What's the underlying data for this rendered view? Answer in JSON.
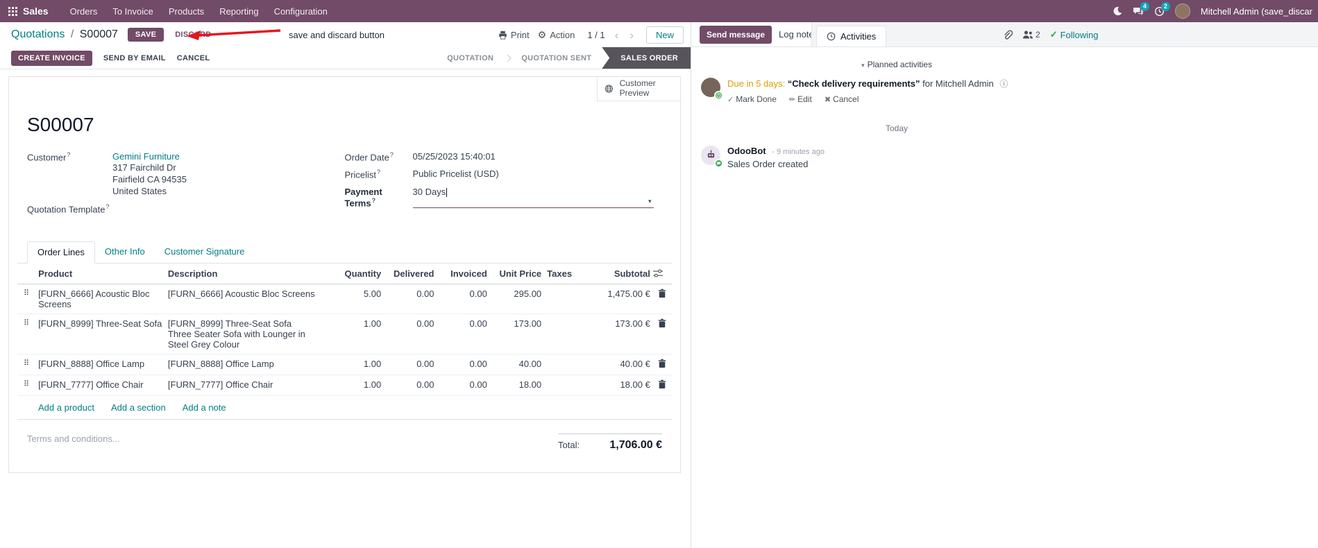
{
  "colors": {
    "primary": "#714B67",
    "link": "#017E84",
    "status_active_bg": "#57545C",
    "warning_text": "#dc9e00",
    "success": "#28a745",
    "badge": "#17a2b8",
    "annotation_red": "#e8141c"
  },
  "nav": {
    "brand": "Sales",
    "menus": [
      "Orders",
      "To Invoice",
      "Products",
      "Reporting",
      "Configuration"
    ],
    "message_badge": "4",
    "activity_badge": "2",
    "user": "Mitchell Admin (save_discar"
  },
  "control": {
    "breadcrumb_parent": "Quotations",
    "breadcrumb_sep": "/",
    "breadcrumb_current": "S00007",
    "save": "SAVE",
    "discard": "DISCARD",
    "annotation": "save and discard button",
    "print": "Print",
    "action": "Action",
    "pager": "1 / 1",
    "prev": "‹",
    "next": "›",
    "new": "New"
  },
  "statusbar": {
    "create_invoice": "CREATE INVOICE",
    "send_by_email": "SEND BY EMAIL",
    "cancel": "CANCEL",
    "stages": [
      {
        "label": "QUOTATION"
      },
      {
        "label": "QUOTATION SENT"
      },
      {
        "label": "SALES ORDER"
      }
    ]
  },
  "sheet": {
    "customer_preview": "Customer Preview",
    "title": "S00007",
    "help_marker": "?",
    "customer_label": "Customer",
    "customer_name": "Gemini Furniture",
    "address_line1": "317 Fairchild Dr",
    "address_line2": "Fairfield CA 94535",
    "address_line3": "United States",
    "quotation_template_label": "Quotation Template",
    "order_date_label": "Order Date",
    "order_date": "05/25/2023 15:40:01",
    "pricelist_label": "Pricelist",
    "pricelist": "Public Pricelist (USD)",
    "payment_terms_label": "Payment Terms",
    "payment_terms": "30 Days",
    "tabs": {
      "order_lines": "Order Lines",
      "other_info": "Other Info",
      "customer_signature": "Customer Signature"
    },
    "table": {
      "headers": {
        "product": "Product",
        "description": "Description",
        "quantity": "Quantity",
        "delivered": "Delivered",
        "invoiced": "Invoiced",
        "unit_price": "Unit Price",
        "taxes": "Taxes",
        "subtotal": "Subtotal"
      },
      "rows": [
        {
          "product": "[FURN_6666] Acoustic Bloc Screens",
          "description": "[FURN_6666] Acoustic Bloc Screens",
          "quantity": "5.00",
          "delivered": "0.00",
          "invoiced": "0.00",
          "unit_price": "295.00",
          "taxes": "",
          "subtotal": "1,475.00 €"
        },
        {
          "product": "[FURN_8999] Three-Seat Sofa",
          "description": "[FURN_8999] Three-Seat Sofa",
          "description2": "Three Seater Sofa with Lounger in Steel Grey Colour",
          "quantity": "1.00",
          "delivered": "0.00",
          "invoiced": "0.00",
          "unit_price": "173.00",
          "taxes": "",
          "subtotal": "173.00 €"
        },
        {
          "product": "[FURN_8888] Office Lamp",
          "description": "[FURN_8888] Office Lamp",
          "quantity": "1.00",
          "delivered": "0.00",
          "invoiced": "0.00",
          "unit_price": "40.00",
          "taxes": "",
          "subtotal": "40.00 €"
        },
        {
          "product": "[FURN_7777] Office Chair",
          "description": "[FURN_7777] Office Chair",
          "quantity": "1.00",
          "delivered": "0.00",
          "invoiced": "0.00",
          "unit_price": "18.00",
          "taxes": "",
          "subtotal": "18.00 €"
        }
      ],
      "add_product": "Add a product",
      "add_section": "Add a section",
      "add_note": "Add a note"
    },
    "terms_placeholder": "Terms and conditions...",
    "total_label": "Total:",
    "total_value": "1,706.00 €"
  },
  "chatter": {
    "send_message": "Send message",
    "log_note": "Log note",
    "activities": "Activities",
    "followers_count": "2",
    "following": "Following",
    "planned_activities": "Planned activities",
    "activity": {
      "due": "Due in 5 days:",
      "summary": "“Check delivery requirements”",
      "assignee": "for Mitchell Admin",
      "mark_done": "Mark Done",
      "edit": "Edit",
      "cancel": "Cancel"
    },
    "date_separator": "Today",
    "message": {
      "author": "OdooBot",
      "time": "- 9 minutes ago",
      "body": "Sales Order created"
    }
  }
}
